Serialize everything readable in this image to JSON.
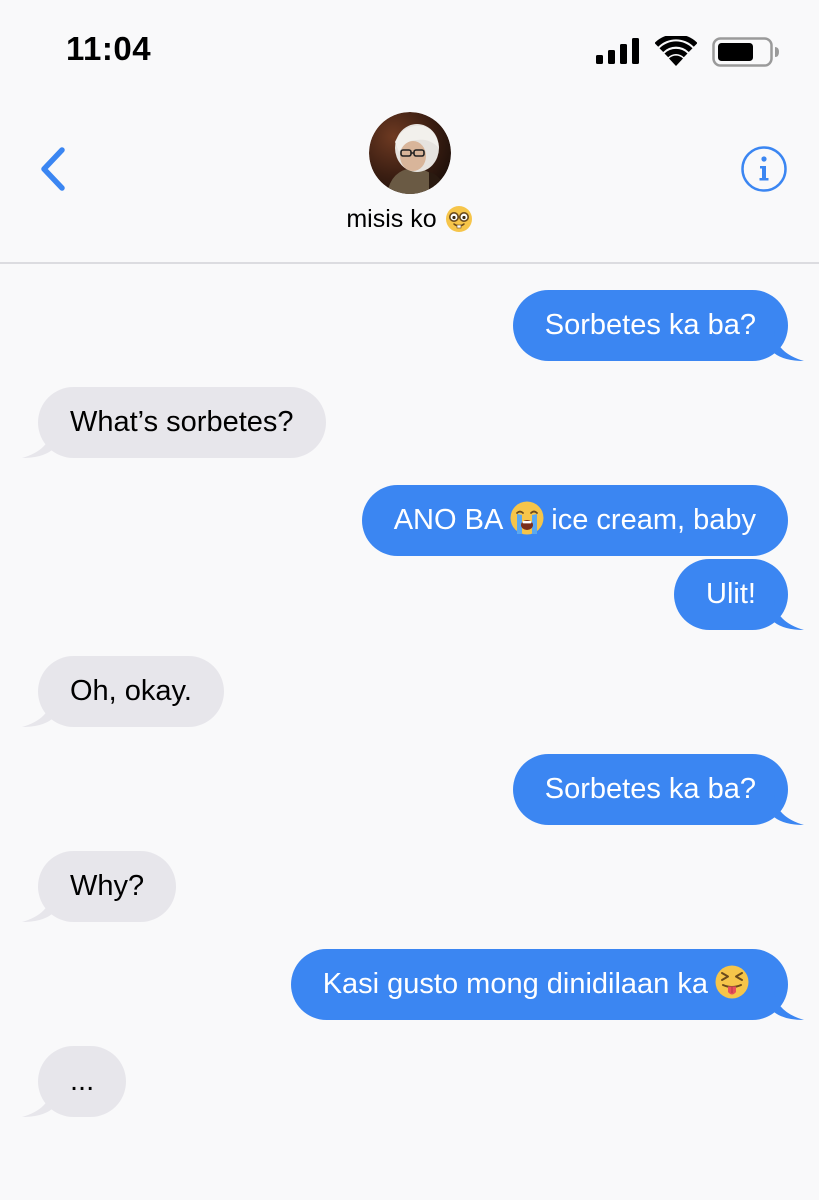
{
  "status_bar": {
    "time": "11:04",
    "icons": [
      "signal-icon",
      "wifi-icon",
      "battery-icon"
    ]
  },
  "header": {
    "back_icon": "chevron-left-icon",
    "contact_name": "misis ko",
    "contact_emoji": "nerd-face-emoji",
    "info_icon": "info-icon"
  },
  "colors": {
    "accent": "#3b86f2",
    "incoming_bubble": "#e7e6eb",
    "background": "#f9f9fa"
  },
  "messages": [
    {
      "direction": "outgoing",
      "text": "Sorbetes ka ba?"
    },
    {
      "direction": "incoming",
      "text": "What’s sorbetes?"
    },
    {
      "direction": "outgoing",
      "text_before": "ANO BA",
      "emoji": "loudly-crying-face-emoji",
      "text_after": "ice cream, baby"
    },
    {
      "direction": "outgoing",
      "text": "Ulit!"
    },
    {
      "direction": "incoming",
      "text": "Oh, okay."
    },
    {
      "direction": "outgoing",
      "text": "Sorbetes ka ba?"
    },
    {
      "direction": "incoming",
      "text": "Why?"
    },
    {
      "direction": "outgoing",
      "text_before": "Kasi gusto mong dinidilaan ka",
      "emoji": "squinting-face-with-tongue-emoji"
    },
    {
      "direction": "incoming",
      "text": "..."
    }
  ]
}
